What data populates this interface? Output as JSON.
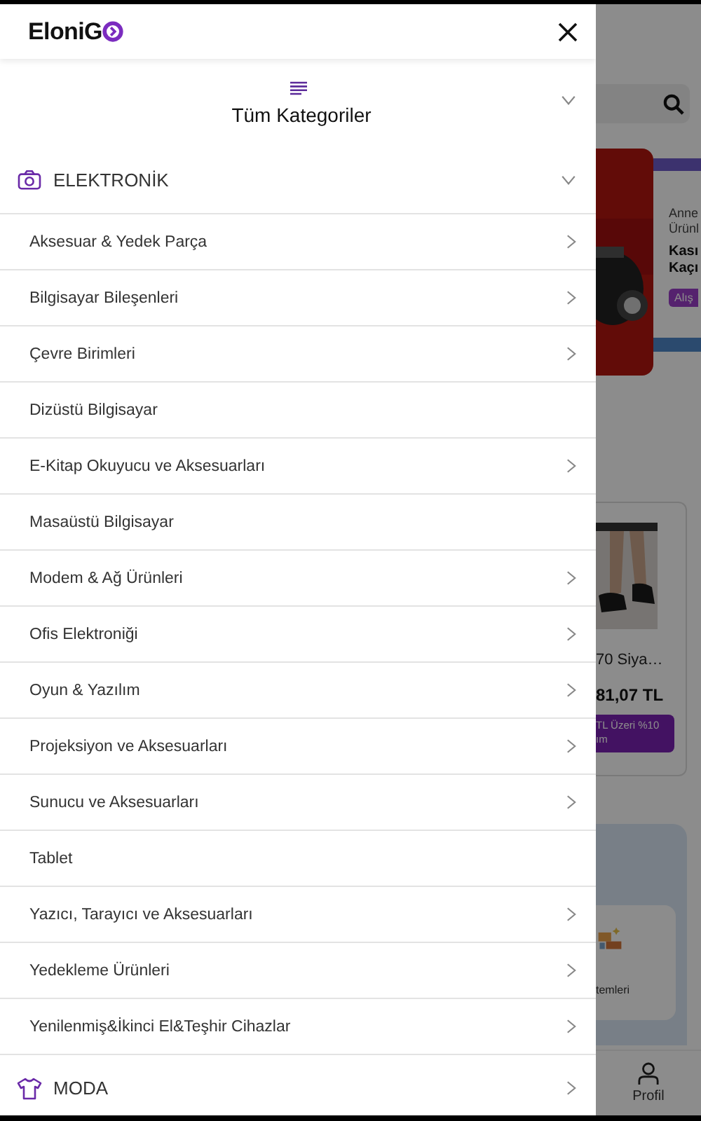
{
  "header": {
    "logo_text": "EloniG"
  },
  "all_categories": {
    "label": "Tüm Kategoriler",
    "expanded": false
  },
  "categories": [
    {
      "label": "ELEKTRONİK",
      "kind": "camera",
      "expanded": true,
      "children": [
        {
          "label": "Aksesuar & Yedek Parça",
          "has_arrow": true
        },
        {
          "label": "Bilgisayar Bileşenleri",
          "has_arrow": true
        },
        {
          "label": "Çevre Birimleri",
          "has_arrow": true
        },
        {
          "label": "Dizüstü Bilgisayar",
          "has_arrow": false
        },
        {
          "label": "E-Kitap Okuyucu ve Aksesuarları",
          "has_arrow": true
        },
        {
          "label": "Masaüstü Bilgisayar",
          "has_arrow": false
        },
        {
          "label": "Modem & Ağ Ürünleri",
          "has_arrow": true
        },
        {
          "label": "Ofis Elektroniği",
          "has_arrow": true
        },
        {
          "label": "Oyun & Yazılım",
          "has_arrow": true
        },
        {
          "label": "Projeksiyon ve Aksesuarları",
          "has_arrow": true
        },
        {
          "label": "Sunucu ve Aksesuarları",
          "has_arrow": true
        },
        {
          "label": "Tablet",
          "has_arrow": false
        },
        {
          "label": "Yazıcı, Tarayıcı ve Aksesuarları",
          "has_arrow": true
        },
        {
          "label": "Yedekleme Ürünleri",
          "has_arrow": true
        },
        {
          "label": "Yenilenmiş&İkinci El&Teşhir Cihazlar",
          "has_arrow": true
        }
      ]
    },
    {
      "label": "MODA",
      "kind": "shirt",
      "expanded": false
    }
  ],
  "background_page": {
    "banner": {
      "lines": [
        "Anne",
        "Ürünl"
      ],
      "headline": [
        "Kası",
        "Kaçı"
      ],
      "button": "Alış"
    },
    "product": {
      "name": "70 Siya…",
      "price": "81,07 TL",
      "promo": [
        "TL Üzeri %10",
        "ım"
      ]
    },
    "category_card": {
      "label": "temleri"
    },
    "bottom_nav": [
      {
        "label": "Profil"
      }
    ]
  }
}
